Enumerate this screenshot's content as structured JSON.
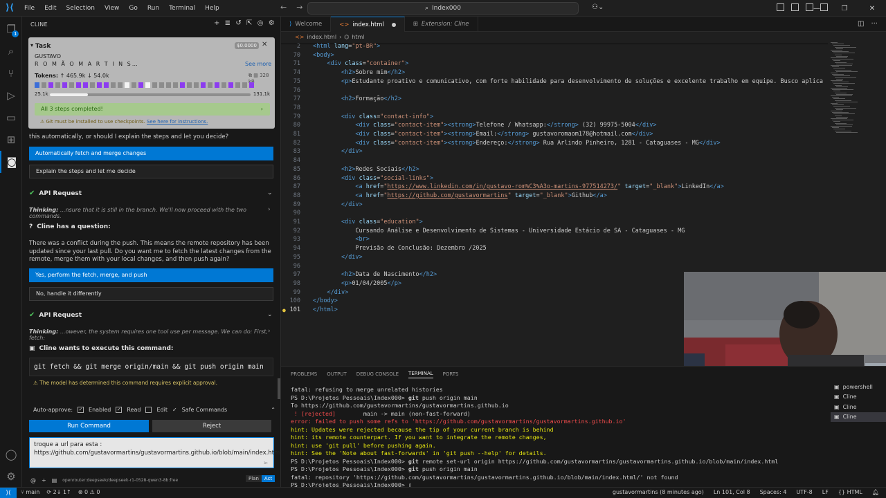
{
  "titlebar": {
    "menu": [
      "File",
      "Edit",
      "Selection",
      "View",
      "Go",
      "Run",
      "Terminal",
      "Help"
    ],
    "search": "Index000"
  },
  "activitybar": {
    "badge": "1"
  },
  "sidebar": {
    "title": "CLINE",
    "task": {
      "label": "Task",
      "cost": "$0.0000",
      "name_line1": "GUSTAVO",
      "name_line2": "R O M Ã O M A R T I N S…",
      "see_more": "See more",
      "tokens_label": "Tokens:",
      "tokens_up": "↑ 465.9k",
      "tokens_down": "↓ 54.0k",
      "size": "328 kB",
      "context_used": "25.1k",
      "context_max": "131.1k",
      "context_fraction": 0.19,
      "steps": "All 3 steps completed!",
      "git_warning": "Git must be installed to use checkpoints.",
      "git_link": "See here for instructions."
    },
    "q1_text": "this automatically, or should I explain the steps and let you decide?",
    "q1_opt1": "Automatically fetch and merge changes",
    "q1_opt2": "Explain the steps and let me decide",
    "api1_title": "API Request",
    "api1_thinking_label": "Thinking:",
    "api1_thinking": "...nsure that it is still in the branch. We'll now proceed with the two commands.",
    "question_title": "Cline has a question:",
    "question_body": "There was a conflict during the push. This means the remote repository has been updated since your last pull. Do you want me to fetch the latest changes from the remote, merge them with your local changes, and then push again?",
    "q2_opt1": "Yes, perform the fetch, merge, and push",
    "q2_opt2": "No, handle it differently",
    "api2_title": "API Request",
    "api2_thinking_label": "Thinking:",
    "api2_thinking": "...owever, the system requires one tool use per message. We can do: First, fetch:",
    "exec_title": "Cline wants to execute this command:",
    "command": "git fetch && git merge origin/main && git push origin main",
    "approval_note": "The model has determined this command requires explicit approval.",
    "autoapprove": {
      "label": "Auto-approve:",
      "enabled": "Enabled",
      "read": "Read",
      "edit": "Edit",
      "safe": "Safe Commands"
    },
    "run_button": "Run Command",
    "reject_button": "Reject",
    "input_text": "troque a url para esta : https://github.com/gustavormartins/gustavormartins.github.io/blob/main/index.html",
    "model": "openrouter:deepseek/deepseek-r1-0528-qwen3-8b:free",
    "plan": "Plan",
    "act": "Act"
  },
  "editor": {
    "tabs": [
      {
        "label": "Welcome"
      },
      {
        "label": "index.html"
      },
      {
        "label": "Extension: Cline"
      }
    ],
    "breadcrumb": [
      "index.html",
      "html"
    ],
    "lines": [
      {
        "n": "2",
        "html": "<span class=\"tg\">&lt;html</span> <span class=\"at\">lang</span>=<span class=\"st\">\"pt-BR\"</span><span class=\"tg\">&gt;</span>"
      },
      {
        "n": "70",
        "html": "<span class=\"tg\">&lt;body&gt;</span>"
      },
      {
        "n": "71",
        "html": "    <span class=\"tg\">&lt;div</span> <span class=\"at\">class</span>=<span class=\"st\">\"container\"</span><span class=\"tg\">&gt;</span>"
      },
      {
        "n": "74",
        "html": "        <span class=\"tg\">&lt;h2&gt;</span>Sobre mim<span class=\"tg\">&lt;/h2&gt;</span>"
      },
      {
        "n": "75",
        "html": "        <span class=\"tg\">&lt;p&gt;</span>Estudante proativo e comunicativo, com forte habilidade para desenvolvimento de soluções e excelente trabalho em equipe. Busco aplica"
      },
      {
        "n": "76",
        "html": ""
      },
      {
        "n": "77",
        "html": "        <span class=\"tg\">&lt;h2&gt;</span>Formação<span class=\"tg\">&lt;/h2&gt;</span>"
      },
      {
        "n": "78",
        "html": ""
      },
      {
        "n": "79",
        "html": "        <span class=\"tg\">&lt;div</span> <span class=\"at\">class</span>=<span class=\"st\">\"contact-info\"</span><span class=\"tg\">&gt;</span>"
      },
      {
        "n": "80",
        "html": "            <span class=\"tg\">&lt;div</span> <span class=\"at\">class</span>=<span class=\"st\">\"contact-item\"</span><span class=\"tg\">&gt;&lt;strong&gt;</span>Telefone / Whatsapp:<span class=\"tg\">&lt;/strong&gt;</span> (32) 99975-5004<span class=\"tg\">&lt;/div&gt;</span>"
      },
      {
        "n": "81",
        "html": "            <span class=\"tg\">&lt;div</span> <span class=\"at\">class</span>=<span class=\"st\">\"contact-item\"</span><span class=\"tg\">&gt;&lt;strong&gt;</span>Email:<span class=\"tg\">&lt;/strong&gt;</span> gustavoromaom178@hotmail.com<span class=\"tg\">&lt;/div&gt;</span>"
      },
      {
        "n": "82",
        "html": "            <span class=\"tg\">&lt;div</span> <span class=\"at\">class</span>=<span class=\"st\">\"contact-item\"</span><span class=\"tg\">&gt;&lt;strong&gt;</span>Endereço:<span class=\"tg\">&lt;/strong&gt;</span> Rua Arlindo Pinheiro, 1281 - Cataguases - MG<span class=\"tg\">&lt;/div&gt;</span>"
      },
      {
        "n": "83",
        "html": "        <span class=\"tg\">&lt;/div&gt;</span>"
      },
      {
        "n": "84",
        "html": ""
      },
      {
        "n": "85",
        "html": "        <span class=\"tg\">&lt;h2&gt;</span>Redes Sociais<span class=\"tg\">&lt;/h2&gt;</span>"
      },
      {
        "n": "86",
        "html": "        <span class=\"tg\">&lt;div</span> <span class=\"at\">class</span>=<span class=\"st\">\"social-links\"</span><span class=\"tg\">&gt;</span>"
      },
      {
        "n": "87",
        "html": "            <span class=\"tg\">&lt;a</span> <span class=\"at\">href</span>=<span class=\"st\">\"</span><span class=\"lk\">https://www.linkedin.com/in/gustavo-rom%C3%A3o-martins-977514273/</span><span class=\"st\">\"</span> <span class=\"at\">target</span>=<span class=\"st\">\"_blank\"</span><span class=\"tg\">&gt;</span>LinkedIn<span class=\"tg\">&lt;/a&gt;</span>"
      },
      {
        "n": "88",
        "html": "            <span class=\"tg\">&lt;a</span> <span class=\"at\">href</span>=<span class=\"st\">\"</span><span class=\"lk\">https://github.com/gustavormartins</span><span class=\"st\">\"</span> <span class=\"at\">target</span>=<span class=\"st\">\"_blank\"</span><span class=\"tg\">&gt;</span>Github<span class=\"tg\">&lt;/a&gt;</span>"
      },
      {
        "n": "89",
        "html": "        <span class=\"tg\">&lt;/div&gt;</span>"
      },
      {
        "n": "90",
        "html": ""
      },
      {
        "n": "91",
        "html": "        <span class=\"tg\">&lt;div</span> <span class=\"at\">class</span>=<span class=\"st\">\"education\"</span><span class=\"tg\">&gt;</span>"
      },
      {
        "n": "92",
        "html": "            Cursando Análise e Desenvolvimento de Sistemas - Universidade Estácio de SA - Cataguases - MG"
      },
      {
        "n": "93",
        "html": "            <span class=\"tg\">&lt;br&gt;</span>"
      },
      {
        "n": "94",
        "html": "            Previsão de Conclusão: Dezembro /2025"
      },
      {
        "n": "95",
        "html": "        <span class=\"tg\">&lt;/div&gt;</span>"
      },
      {
        "n": "96",
        "html": ""
      },
      {
        "n": "97",
        "html": "        <span class=\"tg\">&lt;h2&gt;</span>Data de Nascimento<span class=\"tg\">&lt;/h2&gt;</span>"
      },
      {
        "n": "98",
        "html": "        <span class=\"tg\">&lt;p&gt;</span>01/04/2005<span class=\"tg\">&lt;/p&gt;</span>"
      },
      {
        "n": "99",
        "html": "    <span class=\"tg\">&lt;/div&gt;</span>"
      },
      {
        "n": "100",
        "html": "<span class=\"tg\">&lt;/body&gt;</span>"
      },
      {
        "n": "101",
        "html": "<span class=\"tg\">&lt;/html&gt;</span>"
      }
    ]
  },
  "panel": {
    "tabs": [
      "PROBLEMS",
      "OUTPUT",
      "DEBUG CONSOLE",
      "TERMINAL",
      "PORTS"
    ],
    "active_tab": "TERMINAL",
    "terminal_lines": [
      {
        "c": "",
        "t": "fatal: refusing to merge unrelated histories"
      },
      {
        "c": "",
        "t": "PS D:\\Projetos Pessoais\\Index000> <b>git</b> push origin main"
      },
      {
        "c": "",
        "t": "To https://github.com/gustavormartins/gustavormartins.github.io"
      },
      {
        "c": "",
        "t": " <span class=\"e\">! [rejected]</span>        main -> main (non-fast-forward)"
      },
      {
        "c": "e",
        "t": "error: failed to push some refs to 'https://github.com/gustavormartins/gustavormartins.github.io'"
      },
      {
        "c": "y",
        "t": "hint: Updates were rejected because the tip of your current branch is behind"
      },
      {
        "c": "y",
        "t": "hint: its remote counterpart. If you want to integrate the remote changes,"
      },
      {
        "c": "y",
        "t": "hint: use 'git pull' before pushing again."
      },
      {
        "c": "y",
        "t": "hint: See the 'Note about fast-forwards' in 'git push --help' for details."
      },
      {
        "c": "",
        "t": "PS D:\\Projetos Pessoais\\Index000> <b>git</b> remote set-url origin https://github.com/gustavormartins/gustavormartins.github.io/blob/main/index.html"
      },
      {
        "c": "",
        "t": "PS D:\\Projetos Pessoais\\Index000> <b>git</b> push origin main"
      },
      {
        "c": "",
        "t": "fatal: repository 'https://github.com/gustavormartins/gustavormartins.github.io/blob/main/index.html/' not found"
      },
      {
        "c": "",
        "t": "PS D:\\Projetos Pessoais\\Index000> ▯"
      }
    ],
    "terminals": [
      "powershell",
      "Cline",
      "Cline",
      "Cline"
    ]
  },
  "statusbar": {
    "branch": "main",
    "sync": "2↓ 1↑",
    "errors": "⊗ 0 ⚠ 0",
    "blame": "gustavormartins (8 minutes ago)",
    "position": "Ln 101, Col 8",
    "spaces": "Spaces: 4",
    "encoding": "UTF-8",
    "eol": "LF",
    "language": "HTML"
  },
  "colors": {
    "accent": "#0078d4",
    "success": "#4ec05b",
    "warning": "#d7c266",
    "error": "#f14c4c"
  }
}
